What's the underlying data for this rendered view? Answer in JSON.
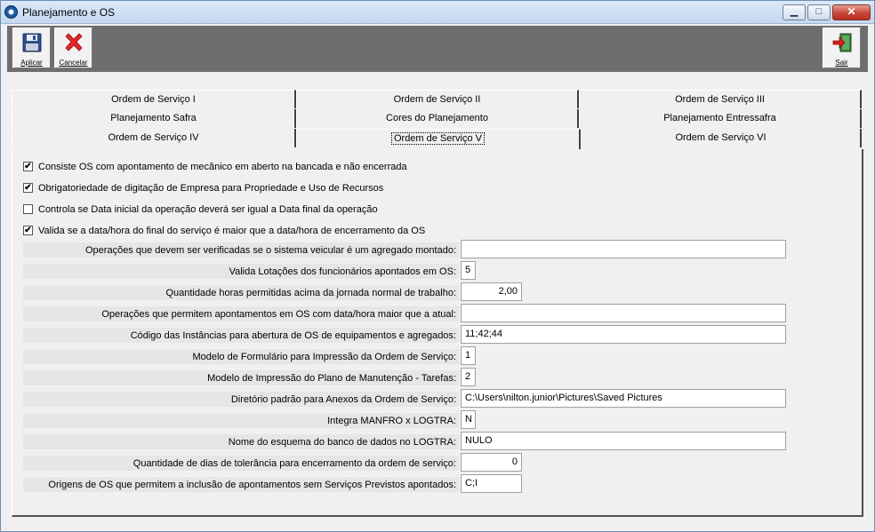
{
  "window": {
    "title": "Planejamento e OS"
  },
  "toolbar": {
    "apply_label": "Aplicar",
    "cancel_label": "Cancelar",
    "exit_label": "Sair"
  },
  "tabs": {
    "row1": [
      "Ordem de Serviço I",
      "Ordem de Serviço II",
      "Ordem de Serviço III"
    ],
    "row2": [
      "Planejamento Safra",
      "Cores do Planejamento",
      "Planejamento Entressafra"
    ],
    "row3": [
      "Ordem de Serviço IV",
      "Ordem de Serviço V",
      "Ordem de Serviço VI"
    ],
    "active": "Ordem de Serviço V"
  },
  "checks": [
    {
      "label": "Consiste OS com apontamento de mecânico em aberto na bancada e não encerrada",
      "checked": true
    },
    {
      "label": "Obrigatoriedade de digitação de Empresa para Propriedade e Uso de Recursos",
      "checked": true
    },
    {
      "label": "Controla se Data inicial da operação deverá ser igual a Data final da operação",
      "checked": false
    },
    {
      "label": "Valida se a data/hora do final do serviço é maior que a data/hora de encerramento da OS",
      "checked": true
    }
  ],
  "fields": [
    {
      "label": "Operações que devem ser verificadas se o sistema veicular é um agregado montado:",
      "value": ""
    },
    {
      "label": "Valida Lotações dos funcionários apontados em OS:",
      "value": "5"
    },
    {
      "label": "Quantidade horas permitidas acima da jornada normal de trabalho:",
      "value": "2,00"
    },
    {
      "label": "Operações que permitem apontamentos em OS com data/hora maior que a atual:",
      "value": ""
    },
    {
      "label": "Código das Instâncias para abertura de OS de equipamentos e agregados:",
      "value": "11;42;44"
    },
    {
      "label": "Modelo de Formulário para Impressão da Ordem de Serviço:",
      "value": "1"
    },
    {
      "label": "Modelo de Impressão do Plano de Manutenção - Tarefas:",
      "value": "2"
    },
    {
      "label": "Diretório padrão para Anexos da Ordem de Serviço:",
      "value": "C:\\Users\\nilton.junior\\Pictures\\Saved Pictures"
    },
    {
      "label": "Integra MANFRO x LOGTRA:",
      "value": "N"
    },
    {
      "label": "Nome do esquema do banco de dados no LOGTRA:",
      "value": "NULO"
    },
    {
      "label": "Quantidade de dias de tolerância para encerramento da ordem de serviço:",
      "value": "0"
    },
    {
      "label": "Origens de OS que permitem a inclusão de apontamentos sem Serviços Previstos apontados:",
      "value": "C;I"
    }
  ]
}
